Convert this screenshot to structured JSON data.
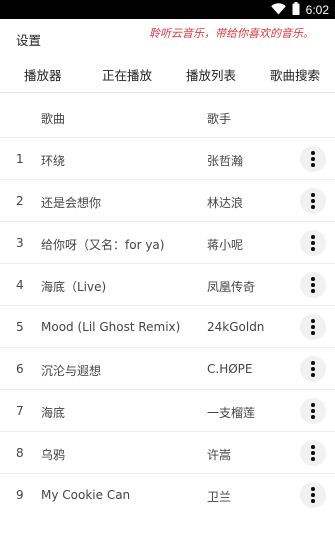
{
  "status_bar": {
    "time": "6:02"
  },
  "app_bar": {
    "title": "设置",
    "marquee": "聆听云音乐，带给你喜欢的音乐。"
  },
  "menu": [
    "播放器",
    "正在播放",
    "播放列表",
    "歌曲搜索"
  ],
  "table": {
    "headers": {
      "song": "歌曲",
      "artist": "歌手"
    },
    "rows": [
      {
        "num": "1",
        "song": "环绕",
        "artist": "张哲瀚"
      },
      {
        "num": "2",
        "song": "还是会想你",
        "artist": "林达浪"
      },
      {
        "num": "3",
        "song": "给你呀（又名：for ya)",
        "artist": "蒋小呢"
      },
      {
        "num": "4",
        "song": "海底（Live)",
        "artist": "凤凰传奇"
      },
      {
        "num": "5",
        "song": "Mood (Lil Ghost Remix)",
        "artist": "24kGoldn"
      },
      {
        "num": "6",
        "song": "沉沦与遐想",
        "artist": "C.HØPE"
      },
      {
        "num": "7",
        "song": "海底",
        "artist": "一支榴莲"
      },
      {
        "num": "8",
        "song": "乌鸦",
        "artist": "许嵩"
      },
      {
        "num": "9",
        "song": "My Cookie Can",
        "artist": "卫兰"
      }
    ]
  },
  "icons": {
    "wifi": "wifi-icon",
    "battery": "battery-icon",
    "more": "more-vert-icon"
  },
  "colors": {
    "accent": "#e4343b",
    "status_bar": "#000000"
  }
}
